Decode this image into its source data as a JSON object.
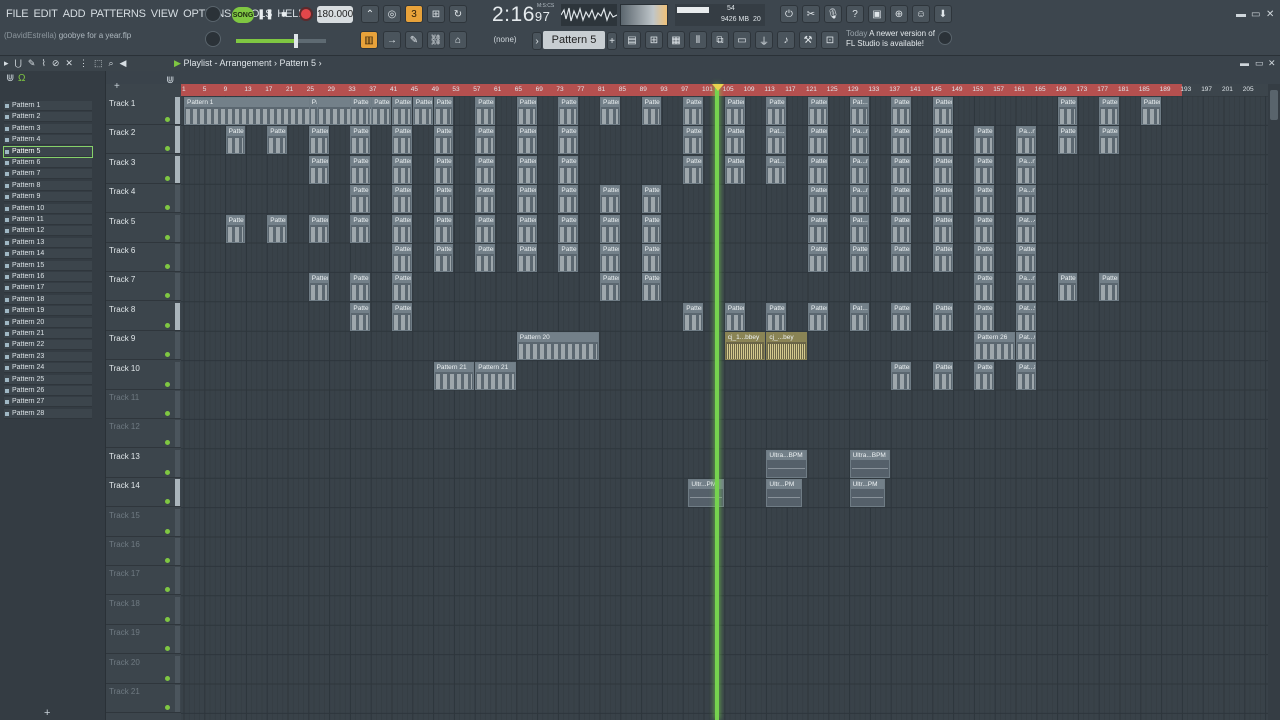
{
  "menu": [
    "FILE",
    "EDIT",
    "ADD",
    "PATTERNS",
    "VIEW",
    "OPTIONS",
    "TOOLS",
    "HELP"
  ],
  "hint": {
    "user": "(DavidEstrella)",
    "project": "goobye for a year.flp"
  },
  "transport": {
    "song_label": "SONG",
    "tempo": "180.000",
    "time_main": "2:16",
    "time_sub": "97",
    "mode_label": "M:S:CS"
  },
  "cpu": {
    "mem": "9426 MB",
    "v1": "54",
    "v2": "20",
    "v3": "0"
  },
  "toolbar2": {
    "snap": "(none)",
    "pattern": "Pattern 5"
  },
  "news": {
    "today": "Today",
    "line1": "A newer version of",
    "line2": "FL Studio is available!"
  },
  "playlist": {
    "title": "Playlist - Arrangement",
    "sep": "›",
    "pattern": "Pattern 5"
  },
  "patterns": [
    "Pattern 1",
    "Pattern 2",
    "Pattern 3",
    "Pattern 4",
    "Pattern 5",
    "Pattern 6",
    "Pattern 7",
    "Pattern 8",
    "Pattern 9",
    "Pattern 10",
    "Pattern 11",
    "Pattern 12",
    "Pattern 13",
    "Pattern 14",
    "Pattern 15",
    "Pattern 16",
    "Pattern 17",
    "Pattern 18",
    "Pattern 19",
    "Pattern 20",
    "Pattern 21",
    "Pattern 22",
    "Pattern 23",
    "Pattern 24",
    "Pattern 25",
    "Pattern 26",
    "Pattern 27",
    "Pattern 28"
  ],
  "selected_pattern": "Pattern 5",
  "tracks": [
    "Track 1",
    "Track 2",
    "Track 3",
    "Track 4",
    "Track 5",
    "Track 6",
    "Track 7",
    "Track 8",
    "Track 9",
    "Track 10",
    "Track 11",
    "Track 12",
    "Track 13",
    "Track 14",
    "Track 15",
    "Track 16",
    "Track 17",
    "Track 18",
    "Track 19",
    "Track 20",
    "Track 21"
  ],
  "ruler": [
    "1",
    "5",
    "9",
    "13",
    "17",
    "21",
    "25",
    "29",
    "33",
    "37",
    "41",
    "45",
    "49",
    "53",
    "57",
    "61",
    "65",
    "69",
    "73",
    "77",
    "81",
    "85",
    "89",
    "93",
    "97",
    "101",
    "105",
    "109",
    "113",
    "117",
    "121",
    "125",
    "129",
    "133",
    "137",
    "141",
    "145",
    "149",
    "153",
    "157",
    "161",
    "165",
    "169",
    "173",
    "177",
    "181",
    "185",
    "189",
    "193",
    "197",
    "201",
    "205"
  ],
  "clips": [
    {
      "track": 0,
      "start": 1,
      "len": 40,
      "label": "Pattern 1"
    },
    {
      "track": 0,
      "start": 25,
      "len": 2,
      "label": "Pattern 1"
    },
    {
      "track": 0,
      "start": 33,
      "len": 4,
      "label": "Pattern 1"
    },
    {
      "track": 0,
      "start": 37,
      "len": 4,
      "label": "Pattern 1"
    },
    {
      "track": 0,
      "start": 41,
      "len": 4,
      "label": "Pattern 1"
    },
    {
      "track": 0,
      "start": 45,
      "len": 4,
      "label": "Pattern 1"
    },
    {
      "track": 0,
      "start": 49,
      "len": 4,
      "label": "Pattern 1"
    },
    {
      "track": 0,
      "start": 57,
      "len": 4,
      "label": "Pattern 1"
    },
    {
      "track": 0,
      "start": 65,
      "len": 4,
      "label": "Pattern 1"
    },
    {
      "track": 0,
      "start": 73,
      "len": 4,
      "label": "Pattern 1"
    },
    {
      "track": 0,
      "start": 81,
      "len": 4,
      "label": "Pattern 2"
    },
    {
      "track": 0,
      "start": 89,
      "len": 4,
      "label": "Pattern 2"
    },
    {
      "track": 0,
      "start": 97,
      "len": 4,
      "label": "Pattern 2"
    },
    {
      "track": 0,
      "start": 105,
      "len": 4,
      "label": "Pattern 2"
    },
    {
      "track": 0,
      "start": 113,
      "len": 4,
      "label": "Pattern 2"
    },
    {
      "track": 0,
      "start": 121,
      "len": 4,
      "label": "Pattern 23"
    },
    {
      "track": 0,
      "start": 129,
      "len": 4,
      "label": "Pat...3"
    },
    {
      "track": 0,
      "start": 137,
      "len": 4,
      "label": "Pattern 23"
    },
    {
      "track": 0,
      "start": 145,
      "len": 4,
      "label": "Pattern 23"
    },
    {
      "track": 0,
      "start": 169,
      "len": 4,
      "label": "Pattern 2"
    },
    {
      "track": 0,
      "start": 177,
      "len": 4,
      "label": "Pattern 2"
    },
    {
      "track": 0,
      "start": 185,
      "len": 4,
      "label": "Pattern 2"
    },
    {
      "track": 1,
      "start": 9,
      "len": 4,
      "label": "Pattern 3"
    },
    {
      "track": 1,
      "start": 17,
      "len": 4,
      "label": "Pattern 3"
    },
    {
      "track": 1,
      "start": 25,
      "len": 4,
      "label": "Pattern 3"
    },
    {
      "track": 1,
      "start": 33,
      "len": 4,
      "label": "Pattern 3"
    },
    {
      "track": 1,
      "start": 41,
      "len": 4,
      "label": "Pattern 3"
    },
    {
      "track": 1,
      "start": 49,
      "len": 4,
      "label": "Pattern 3"
    },
    {
      "track": 1,
      "start": 57,
      "len": 4,
      "label": "Pattern 3"
    },
    {
      "track": 1,
      "start": 65,
      "len": 4,
      "label": "Pattern 3"
    },
    {
      "track": 1,
      "start": 73,
      "len": 4,
      "label": "Pattern 3"
    },
    {
      "track": 1,
      "start": 97,
      "len": 4,
      "label": "Pattern 3"
    },
    {
      "track": 1,
      "start": 105,
      "len": 4,
      "label": "Pattern 3"
    },
    {
      "track": 1,
      "start": 113,
      "len": 4,
      "label": "Pat...rn 3"
    },
    {
      "track": 1,
      "start": 121,
      "len": 4,
      "label": "Pattern 3"
    },
    {
      "track": 1,
      "start": 129,
      "len": 4,
      "label": "Pa...n 3"
    },
    {
      "track": 1,
      "start": 137,
      "len": 4,
      "label": "Pattern 3"
    },
    {
      "track": 1,
      "start": 145,
      "len": 4,
      "label": "Pattern 3"
    },
    {
      "track": 1,
      "start": 153,
      "len": 4,
      "label": "Pattern 3"
    },
    {
      "track": 1,
      "start": 161,
      "len": 4,
      "label": "Pa...n 3"
    },
    {
      "track": 1,
      "start": 169,
      "len": 4,
      "label": "Pattern 3"
    },
    {
      "track": 1,
      "start": 177,
      "len": 4,
      "label": "Pattern 3"
    },
    {
      "track": 2,
      "start": 25,
      "len": 4,
      "label": "Pattern 4"
    },
    {
      "track": 2,
      "start": 33,
      "len": 4,
      "label": "Pattern 4"
    },
    {
      "track": 2,
      "start": 41,
      "len": 4,
      "label": "Pattern 4"
    },
    {
      "track": 2,
      "start": 49,
      "len": 4,
      "label": "Pattern 4"
    },
    {
      "track": 2,
      "start": 57,
      "len": 4,
      "label": "Pattern 4"
    },
    {
      "track": 2,
      "start": 65,
      "len": 4,
      "label": "Pattern 4"
    },
    {
      "track": 2,
      "start": 73,
      "len": 4,
      "label": "Pattern 4"
    },
    {
      "track": 2,
      "start": 97,
      "len": 4,
      "label": "Pattern 4"
    },
    {
      "track": 2,
      "start": 105,
      "len": 4,
      "label": "Pattern 4"
    },
    {
      "track": 2,
      "start": 113,
      "len": 4,
      "label": "Pat...rn 4"
    },
    {
      "track": 2,
      "start": 121,
      "len": 4,
      "label": "Pattern 2"
    },
    {
      "track": 2,
      "start": 129,
      "len": 4,
      "label": "Pa...n 2"
    },
    {
      "track": 2,
      "start": 137,
      "len": 4,
      "label": "Pattern 2"
    },
    {
      "track": 2,
      "start": 145,
      "len": 4,
      "label": "Pattern 2"
    },
    {
      "track": 2,
      "start": 153,
      "len": 4,
      "label": "Pattern 2"
    },
    {
      "track": 2,
      "start": 161,
      "len": 4,
      "label": "Pa...n 2"
    },
    {
      "track": 3,
      "start": 33,
      "len": 4,
      "label": "Pattern 5"
    },
    {
      "track": 3,
      "start": 41,
      "len": 4,
      "label": "Pattern 5"
    },
    {
      "track": 3,
      "start": 49,
      "len": 4,
      "label": "Pattern 7"
    },
    {
      "track": 3,
      "start": 57,
      "len": 4,
      "label": "Pattern 7"
    },
    {
      "track": 3,
      "start": 65,
      "len": 4,
      "label": "Pattern 7"
    },
    {
      "track": 3,
      "start": 73,
      "len": 4,
      "label": "Pattern 7"
    },
    {
      "track": 3,
      "start": 81,
      "len": 4,
      "label": "Pattern 7"
    },
    {
      "track": 3,
      "start": 89,
      "len": 4,
      "label": "Pattern 7"
    },
    {
      "track": 3,
      "start": 121,
      "len": 4,
      "label": "Pattern 5"
    },
    {
      "track": 3,
      "start": 129,
      "len": 4,
      "label": "Pa...n 5"
    },
    {
      "track": 3,
      "start": 137,
      "len": 4,
      "label": "Pattern 6"
    },
    {
      "track": 3,
      "start": 145,
      "len": 4,
      "label": "Pattern 6"
    },
    {
      "track": 3,
      "start": 153,
      "len": 4,
      "label": "Pattern 6"
    },
    {
      "track": 3,
      "start": 161,
      "len": 4,
      "label": "Pa...n 6"
    },
    {
      "track": 4,
      "start": 9,
      "len": 4,
      "label": "Pattern 8"
    },
    {
      "track": 4,
      "start": 17,
      "len": 4,
      "label": "Pattern 8"
    },
    {
      "track": 4,
      "start": 25,
      "len": 4,
      "label": "Pattern 9"
    },
    {
      "track": 4,
      "start": 33,
      "len": 4,
      "label": "Pattern 10"
    },
    {
      "track": 4,
      "start": 41,
      "len": 4,
      "label": "Pattern 11"
    },
    {
      "track": 4,
      "start": 49,
      "len": 4,
      "label": "Pattern 14"
    },
    {
      "track": 4,
      "start": 57,
      "len": 4,
      "label": "Pattern 14"
    },
    {
      "track": 4,
      "start": 65,
      "len": 4,
      "label": "Pattern 15"
    },
    {
      "track": 4,
      "start": 73,
      "len": 4,
      "label": "Pattern 16"
    },
    {
      "track": 4,
      "start": 81,
      "len": 4,
      "label": "Pattern 14"
    },
    {
      "track": 4,
      "start": 89,
      "len": 4,
      "label": "Pattern 16"
    },
    {
      "track": 4,
      "start": 121,
      "len": 4,
      "label": "Pattern 24"
    },
    {
      "track": 4,
      "start": 129,
      "len": 4,
      "label": "Pat...4"
    },
    {
      "track": 4,
      "start": 137,
      "len": 4,
      "label": "Pattern 24"
    },
    {
      "track": 4,
      "start": 145,
      "len": 4,
      "label": "Pattern 24"
    },
    {
      "track": 4,
      "start": 153,
      "len": 4,
      "label": "Pattern 24"
    },
    {
      "track": 4,
      "start": 161,
      "len": 4,
      "label": "Pat...4"
    },
    {
      "track": 5,
      "start": 41,
      "len": 4,
      "label": "Pattern 12"
    },
    {
      "track": 5,
      "start": 49,
      "len": 4,
      "label": "Pattern 17"
    },
    {
      "track": 5,
      "start": 57,
      "len": 4,
      "label": "Pattern 17"
    },
    {
      "track": 5,
      "start": 65,
      "len": 4,
      "label": "Pattern 17"
    },
    {
      "track": 5,
      "start": 73,
      "len": 4,
      "label": "Pattern 17"
    },
    {
      "track": 5,
      "start": 81,
      "len": 4,
      "label": "Pattern 17"
    },
    {
      "track": 5,
      "start": 89,
      "len": 4,
      "label": "Pattern 17"
    },
    {
      "track": 5,
      "start": 121,
      "len": 4,
      "label": "Pattern 25"
    },
    {
      "track": 5,
      "start": 129,
      "len": 4,
      "label": "Pattern 25"
    },
    {
      "track": 5,
      "start": 137,
      "len": 4,
      "label": "Pattern 25"
    },
    {
      "track": 5,
      "start": 145,
      "len": 4,
      "label": "Pattern 25"
    },
    {
      "track": 5,
      "start": 153,
      "len": 4,
      "label": "Pattern 25"
    },
    {
      "track": 5,
      "start": 161,
      "len": 4,
      "label": "Pattern 25"
    },
    {
      "track": 6,
      "start": 25,
      "len": 4,
      "label": "Pattern 13"
    },
    {
      "track": 6,
      "start": 33,
      "len": 4,
      "label": "Pattern 13"
    },
    {
      "track": 6,
      "start": 41,
      "len": 4,
      "label": "Pattern 13"
    },
    {
      "track": 6,
      "start": 81,
      "len": 4,
      "label": "Pattern 22"
    },
    {
      "track": 6,
      "start": 89,
      "len": 4,
      "label": "Pattern 22"
    },
    {
      "track": 6,
      "start": 153,
      "len": 4,
      "label": "Pattern 4"
    },
    {
      "track": 6,
      "start": 161,
      "len": 4,
      "label": "Pa...n 4"
    },
    {
      "track": 6,
      "start": 169,
      "len": 4,
      "label": "Pattern 22"
    },
    {
      "track": 6,
      "start": 177,
      "len": 4,
      "label": "Pattern 22"
    },
    {
      "track": 7,
      "start": 33,
      "len": 4,
      "label": "Pattern 18"
    },
    {
      "track": 7,
      "start": 41,
      "len": 4,
      "label": "Pattern 18"
    },
    {
      "track": 7,
      "start": 97,
      "len": 4,
      "label": "Pattern 18"
    },
    {
      "track": 7,
      "start": 105,
      "len": 4,
      "label": "Pattern 18"
    },
    {
      "track": 7,
      "start": 113,
      "len": 4,
      "label": "Pattern 18"
    },
    {
      "track": 7,
      "start": 121,
      "len": 4,
      "label": "Pattern 18"
    },
    {
      "track": 7,
      "start": 129,
      "len": 4,
      "label": "Pat...8"
    },
    {
      "track": 7,
      "start": 137,
      "len": 4,
      "label": "Pattern 19"
    },
    {
      "track": 7,
      "start": 145,
      "len": 4,
      "label": "Pattern 19"
    },
    {
      "track": 7,
      "start": 153,
      "len": 4,
      "label": "Pattern 19"
    },
    {
      "track": 7,
      "start": 161,
      "len": 4,
      "label": "Pat...9"
    },
    {
      "track": 8,
      "start": 65,
      "len": 16,
      "label": "Pattern 20"
    },
    {
      "track": 8,
      "start": 153,
      "len": 8,
      "label": "Pattern 26"
    },
    {
      "track": 8,
      "start": 161,
      "len": 4,
      "label": "Pat...6"
    },
    {
      "track": 9,
      "start": 49,
      "len": 8,
      "label": "Pattern 21"
    },
    {
      "track": 9,
      "start": 57,
      "len": 8,
      "label": "Pattern 21"
    },
    {
      "track": 9,
      "start": 137,
      "len": 4,
      "label": "Pattern 27"
    },
    {
      "track": 9,
      "start": 145,
      "len": 4,
      "label": "Pattern 27"
    },
    {
      "track": 9,
      "start": 153,
      "len": 4,
      "label": "Pattern 27"
    },
    {
      "track": 9,
      "start": 161,
      "len": 4,
      "label": "Pat...8"
    }
  ],
  "audio_clips": [
    {
      "track": 8,
      "start": 105,
      "len": 8,
      "label": "cj_1...bbey"
    },
    {
      "track": 8,
      "start": 113,
      "len": 8,
      "label": "cj_...bey"
    }
  ],
  "auto_clips": [
    {
      "track": 12,
      "start": 113,
      "len": 8,
      "label": "Ultra...BPM"
    },
    {
      "track": 12,
      "start": 129,
      "len": 8,
      "label": "Ultra...BPM"
    },
    {
      "track": 13,
      "start": 98,
      "len": 7,
      "label": "Ultr...PM"
    },
    {
      "track": 13,
      "start": 113,
      "len": 7,
      "label": "Ultr...PM"
    },
    {
      "track": 13,
      "start": 129,
      "len": 7,
      "label": "Ultr...PM"
    }
  ],
  "colors": {
    "accent": "#7fc742",
    "ruler": "#b5504f",
    "playhead": "#76d34f"
  }
}
